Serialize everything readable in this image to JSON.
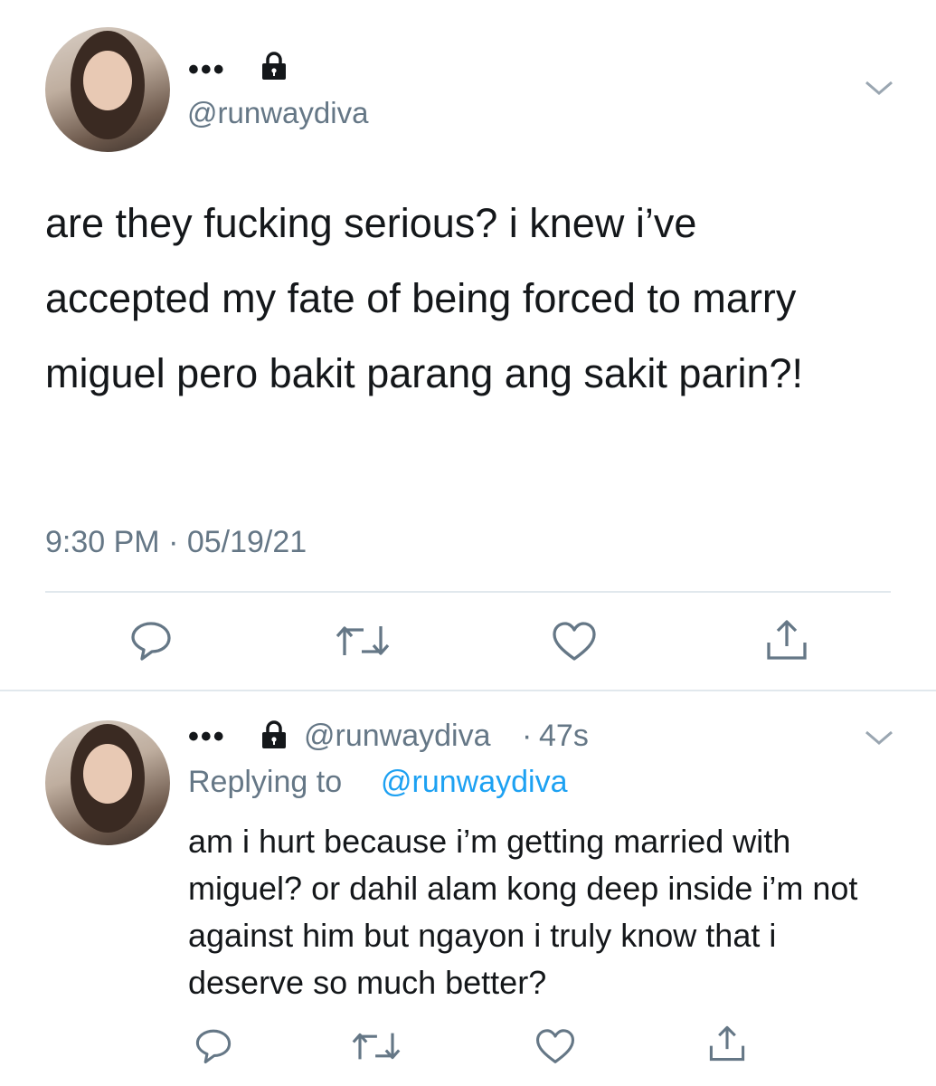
{
  "main_tweet": {
    "display_name": "•••",
    "lock_icon": "lock-icon",
    "handle": "@runwaydiva",
    "text": "are they fucking serious? i knew i’ve accepted my fate of being forced to marry miguel pero bakit parang ang sakit parin?!",
    "timestamp": "9:30 PM · 05/19/21"
  },
  "reply_tweet": {
    "display_name": "•••",
    "lock_icon": "lock-icon",
    "handle": "@runwaydiva",
    "time_sep": "·",
    "time": "47s",
    "replying_prefix": "Replying to",
    "replying_to": "@runwaydiva",
    "text": "am i hurt because i’m getting married with miguel? or dahil alam kong deep inside i’m not against him but ngayon i truly know that i deserve so much better?"
  },
  "actions": [
    "reply-icon",
    "retweet-icon",
    "like-icon",
    "share-icon"
  ],
  "colors": {
    "text": "#14171a",
    "secondary": "#657786",
    "link": "#1da1f2",
    "divider": "#e1e8ed"
  }
}
